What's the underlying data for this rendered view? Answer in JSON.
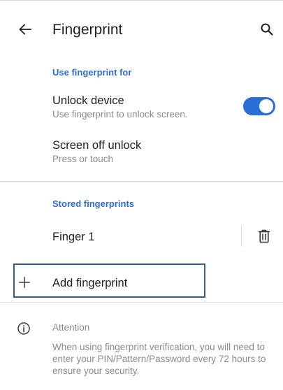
{
  "app_bar": {
    "title": "Fingerprint",
    "back_icon": "arrow-back-icon",
    "search_icon": "search-icon"
  },
  "sections": {
    "use_fingerprint_for": {
      "header": "Use fingerprint for",
      "unlock_device": {
        "title": "Unlock device",
        "summary": "Use fingerprint to unlock screen.",
        "toggle_on": true
      },
      "screen_off_unlock": {
        "title": "Screen off unlock",
        "summary": "Press or touch"
      }
    },
    "stored_fingerprints": {
      "header": "Stored fingerprints",
      "items": [
        {
          "label": "Finger 1",
          "delete_icon": "trash-icon"
        }
      ],
      "add_label": "Add fingerprint",
      "add_icon": "plus-icon"
    },
    "attention": {
      "icon": "info-icon",
      "title": "Attention",
      "body": "When using fingerprint verification, you will need to enter your PIN/Pattern/Password every 72 hours to ensure your security."
    }
  },
  "colors": {
    "accent": "#2a6fd6",
    "primary_text": "#1f1f1f",
    "secondary_text": "#8c8c8c",
    "divider": "#e2e2e2",
    "focus_border": "#2e5f8a"
  }
}
